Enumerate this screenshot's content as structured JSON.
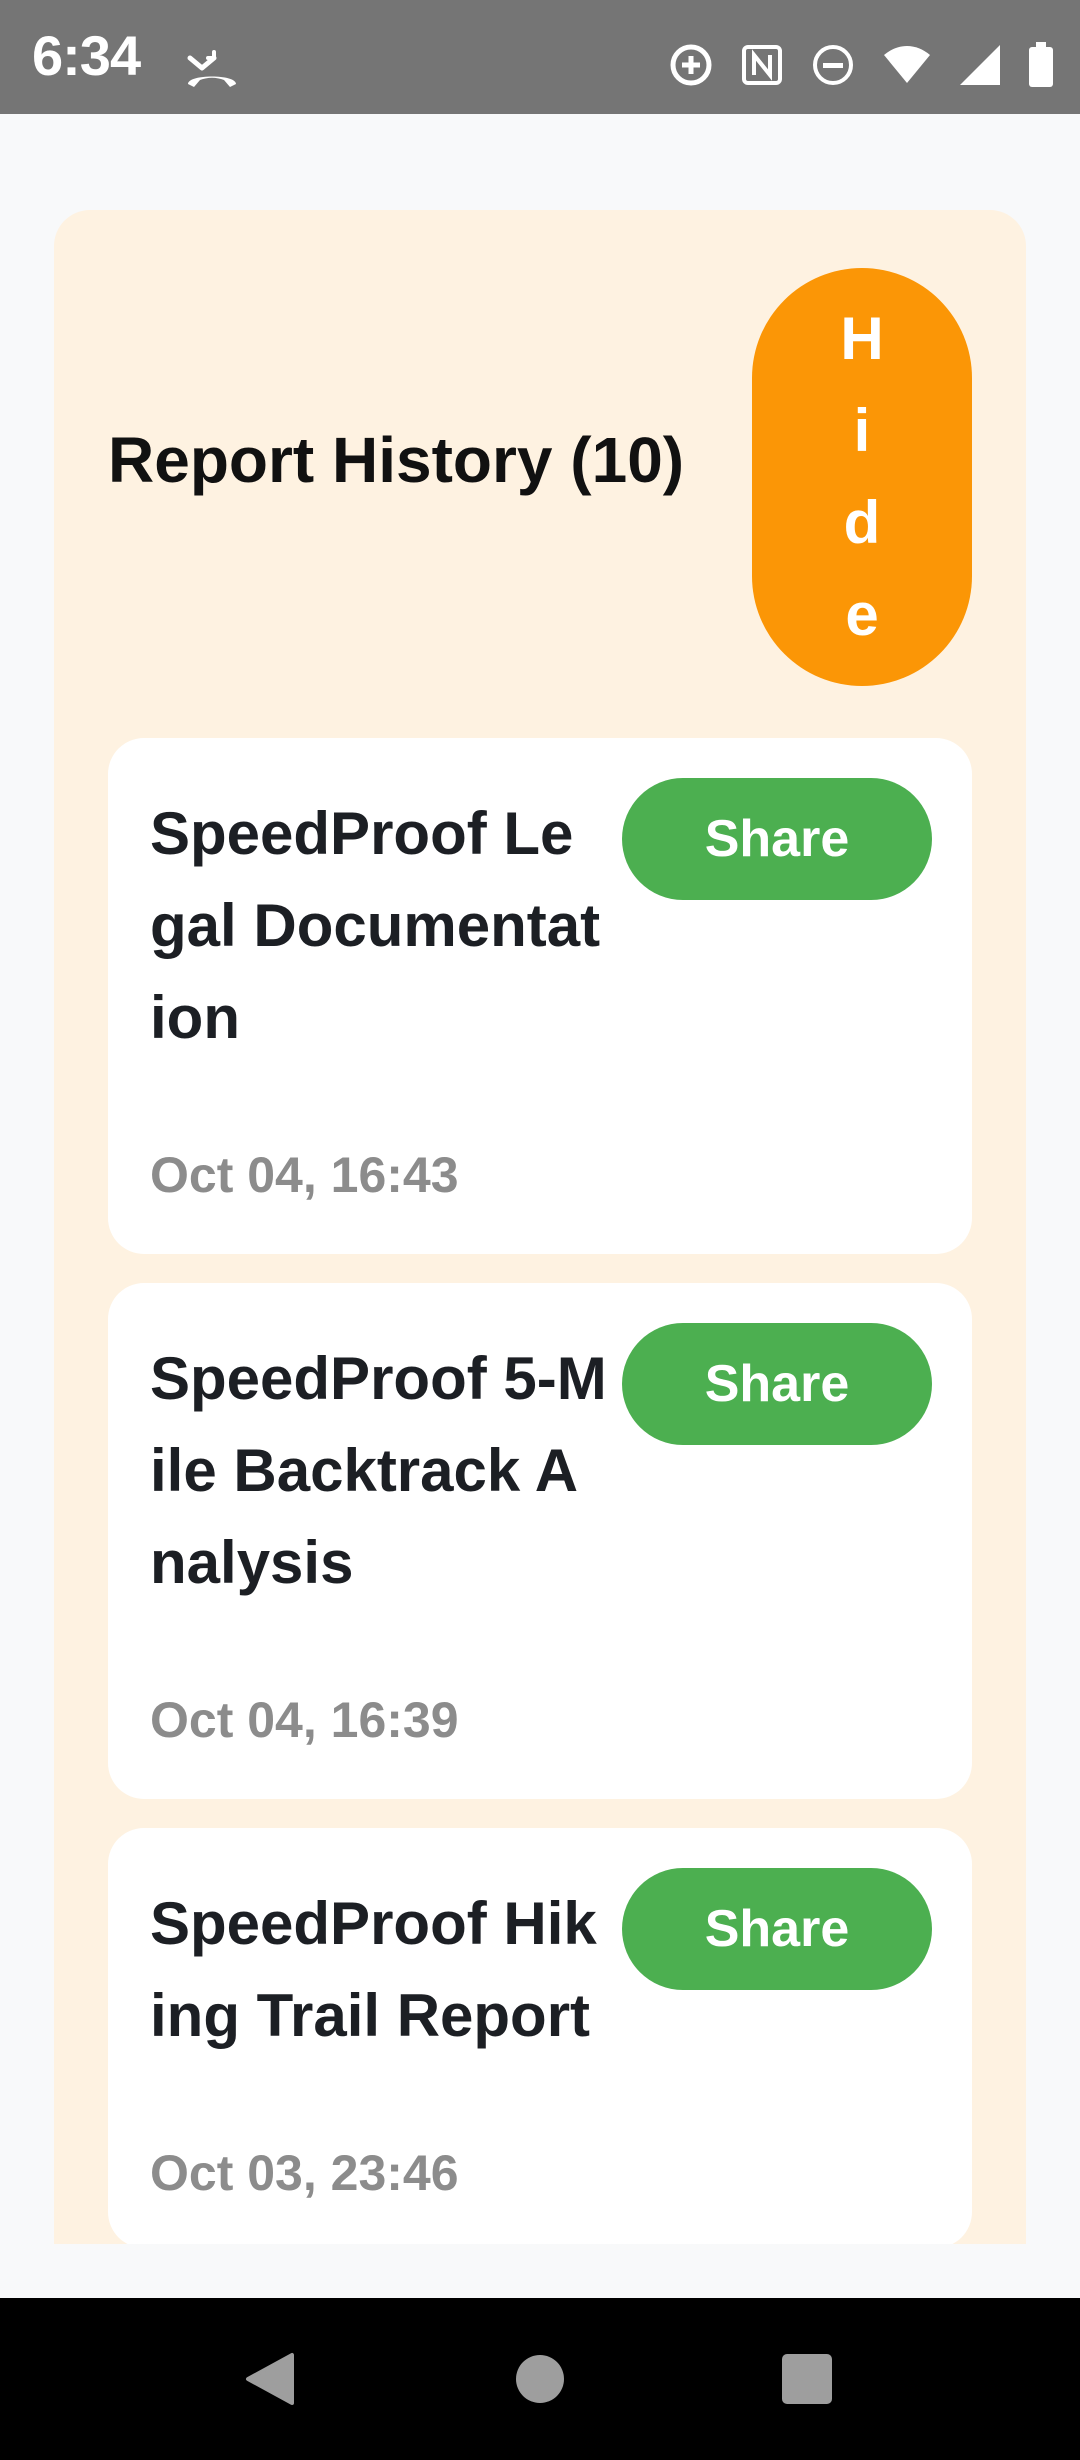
{
  "status_bar": {
    "time": "6:34",
    "left_icon": "missed-call-icon",
    "right_icons": [
      "data-saver-icon",
      "nfc-icon",
      "do-not-disturb-icon",
      "wifi-icon",
      "cell-signal-icon",
      "battery-icon"
    ]
  },
  "report_history": {
    "title": "Report History (10)",
    "hide_label": [
      "H",
      "i",
      "d",
      "e"
    ],
    "colors": {
      "panel": "#fef2e1",
      "hide_button": "#fb9606",
      "share_button": "#4caf50",
      "date_text": "#8c8c8c"
    },
    "reports": [
      {
        "title": "SpeedProof Legal Documentation",
        "date": "Oct 04, 16:43",
        "share_label": "Share"
      },
      {
        "title": "SpeedProof 5-Mile Backtrack Analysis",
        "date": "Oct 04, 16:39",
        "share_label": "Share"
      },
      {
        "title": "SpeedProof Hiking Trail Report",
        "date": "Oct 03, 23:46",
        "share_label": "Share"
      }
    ]
  },
  "nav_bar": {
    "buttons": [
      "back-icon",
      "home-icon",
      "recents-icon"
    ]
  }
}
